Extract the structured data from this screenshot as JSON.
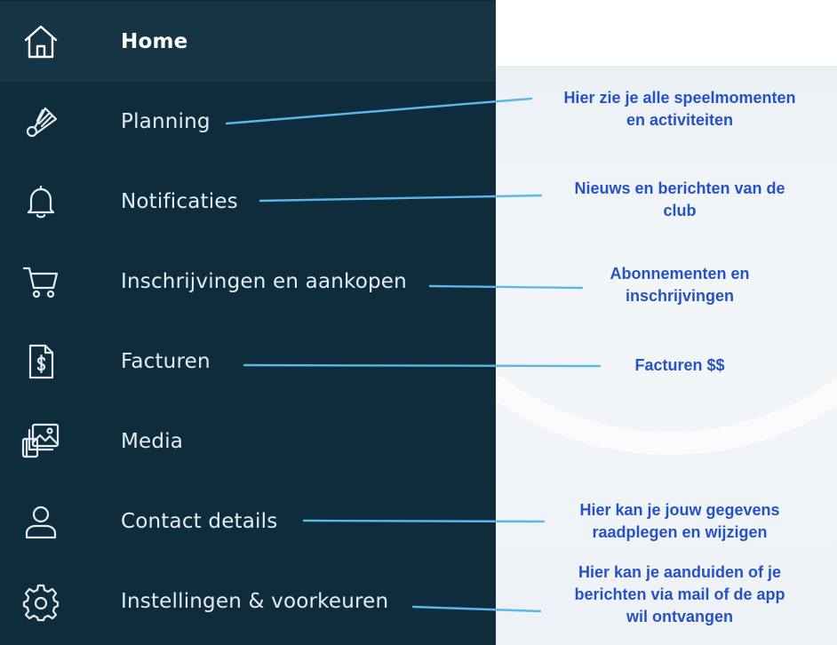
{
  "sidebar": {
    "items": [
      {
        "label": "Home",
        "icon": "home-icon",
        "active": true
      },
      {
        "label": "Planning",
        "icon": "shuttlecock-icon"
      },
      {
        "label": "Notificaties",
        "icon": "bell-icon"
      },
      {
        "label": "Inschrijvingen en aankopen",
        "icon": "cart-icon"
      },
      {
        "label": "Facturen",
        "icon": "invoice-icon"
      },
      {
        "label": "Media",
        "icon": "media-gallery-icon"
      },
      {
        "label": "Contact details",
        "icon": "user-icon"
      },
      {
        "label": "Instellingen & voorkeuren",
        "icon": "gear-icon"
      }
    ]
  },
  "annotations": [
    {
      "line1": "Hier zie je alle speelmomenten",
      "line2": "en activiteiten"
    },
    {
      "line1": "Nieuws en berichten van de",
      "line2": "club"
    },
    {
      "line1": "Abonnementen en",
      "line2": "inschrijvingen"
    },
    {
      "line1": "Facturen $$"
    },
    {
      "line1": "Hier kan je jouw gegevens",
      "line2": "raadplegen en wijzigen"
    },
    {
      "line1": "Hier kan je aanduiden of je",
      "line2": "berichten via mail of de app",
      "line3": "wil ontvangen"
    }
  ],
  "colors": {
    "sidebar_bg": "#0f2c3d",
    "active_item_bg": "#173445",
    "annotation_text": "#2553c7",
    "annotation_line": "#5bb8e6"
  }
}
